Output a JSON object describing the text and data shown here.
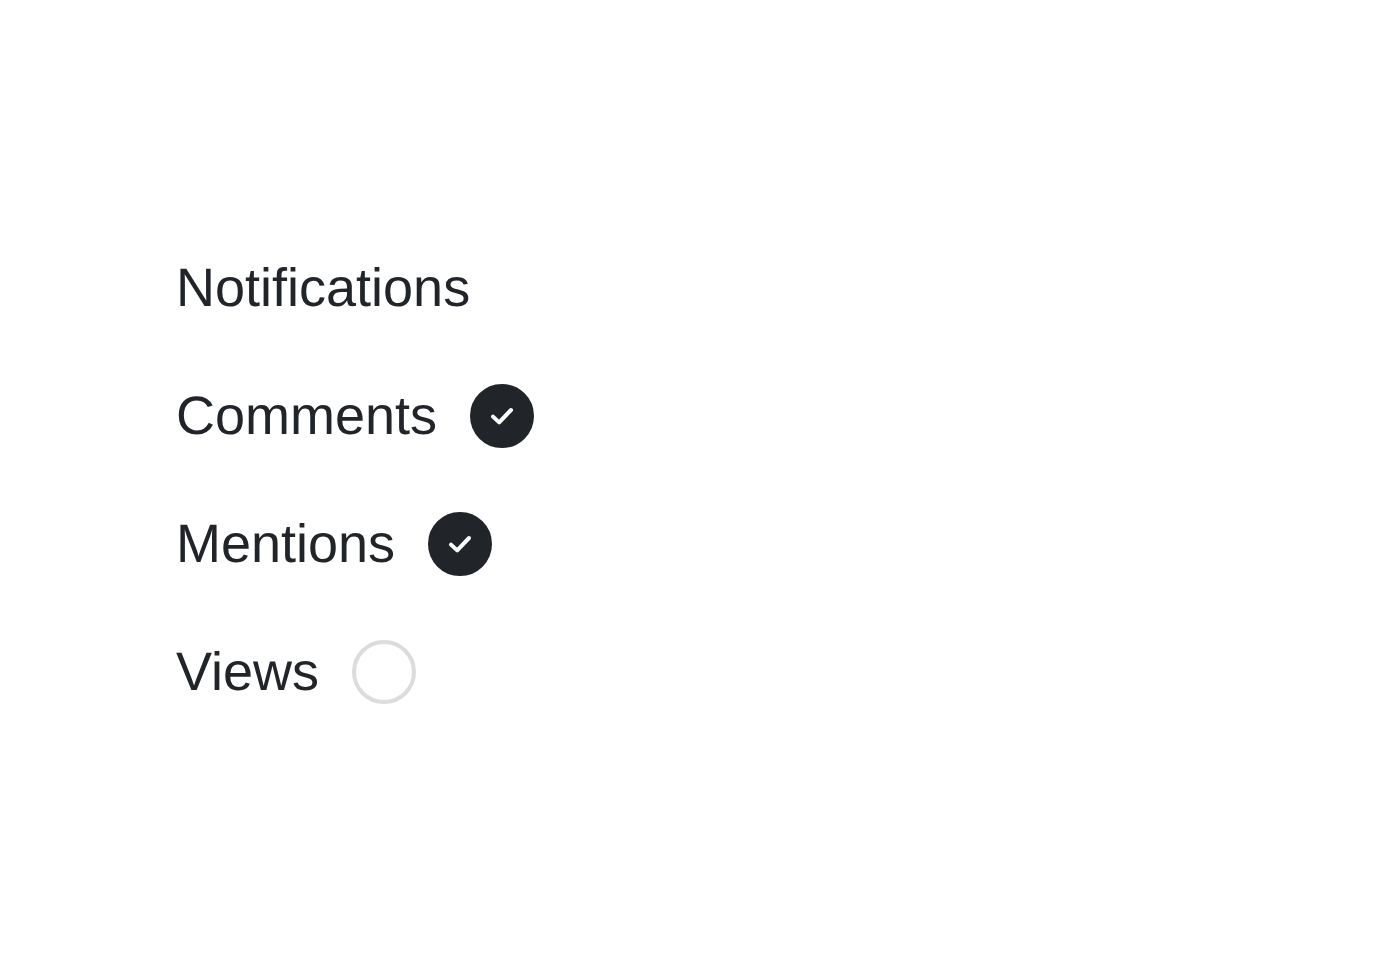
{
  "title": "Notifications",
  "options": [
    {
      "label": "Comments",
      "checked": true
    },
    {
      "label": "Mentions",
      "checked": true
    },
    {
      "label": "Views",
      "checked": false
    }
  ]
}
